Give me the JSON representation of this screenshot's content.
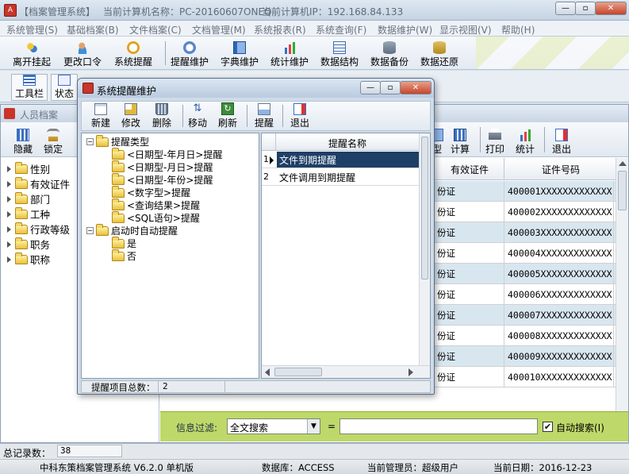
{
  "main_window": {
    "title": "【档案管理系统】",
    "computer_label": "当前计算机名称：PC-20160607ONEQ",
    "ip_label": "当前计算机IP：192.168.84.133"
  },
  "menu": [
    "系统管理(S)",
    "基础档案(B)",
    "文件档案(C)",
    "文档管理(M)",
    "系统报表(R)",
    "系统查询(F)",
    "数据维护(W)",
    "显示视图(V)",
    "帮助(H)"
  ],
  "main_toolbar": [
    "离开挂起",
    "更改口令",
    "系统提醒",
    "提醒维护",
    "字典维护",
    "统计维护",
    "数据结构",
    "数据备份",
    "数据还原"
  ],
  "sub_toolbar": [
    "工具栏",
    "状态"
  ],
  "person_window": {
    "title": "人员档案",
    "toolbar_left": [
      "隐藏",
      "锁定"
    ],
    "toolbar_right": [
      "型",
      "计算",
      "打印",
      "统计",
      "退出"
    ],
    "tree": [
      "性别",
      "有效证件",
      "部门",
      "工种",
      "行政等级",
      "职务",
      "职称"
    ],
    "grid_headers": [
      "有效证件",
      "证件号码"
    ],
    "rows": [
      [
        "份证",
        "400001XXXXXXXXXXXXX"
      ],
      [
        "份证",
        "400002XXXXXXXXXXXXX"
      ],
      [
        "份证",
        "400003XXXXXXXXXXXXX"
      ],
      [
        "份证",
        "400004XXXXXXXXXXXXX"
      ],
      [
        "份证",
        "400005XXXXXXXXXXXXX"
      ],
      [
        "份证",
        "400006XXXXXXXXXXXXX"
      ],
      [
        "份证",
        "400007XXXXXXXXXXXXX"
      ],
      [
        "份证",
        "400008XXXXXXXXXXXXX"
      ],
      [
        "份证",
        "400009XXXXXXXXXXXXX"
      ],
      [
        "份证",
        "400010XXXXXXXXXXXXX"
      ]
    ],
    "filter_label": "信息过滤:",
    "filter_value": "全文搜索",
    "equals": "=",
    "auto_search_label": "自动搜索(I)",
    "auto_search_checked": true
  },
  "dialog": {
    "title": "系统提醒维护",
    "toolbar": [
      "新建",
      "修改",
      "删除",
      "移动",
      "刷新",
      "提醒",
      "退出"
    ],
    "tree": [
      {
        "label": "提醒类型",
        "level": 0
      },
      {
        "label": "<日期型-年月日>提醒",
        "level": 1
      },
      {
        "label": "<日期型-月日>提醒",
        "level": 1
      },
      {
        "label": "<日期型-年份>提醒",
        "level": 1
      },
      {
        "label": "<数字型>提醒",
        "level": 1
      },
      {
        "label": "<查询结果>提醒",
        "level": 1
      },
      {
        "label": "<SQL语句>提醒",
        "level": 1
      },
      {
        "label": "启动时自动提醒",
        "level": 0
      },
      {
        "label": "是",
        "level": 1
      },
      {
        "label": "否",
        "level": 1
      }
    ],
    "grid_header": "提醒名称",
    "grid_rows": [
      {
        "num": "1",
        "name": "文件到期提醒"
      },
      {
        "num": "2",
        "name": "文件调用到期提醒"
      }
    ],
    "status_label": "提醒项目总数：",
    "status_value": "2"
  },
  "statusbar": {
    "total_label": "总记录数：",
    "total_value": "38",
    "product": "中科东策档案管理系统 V6.2.0 单机版",
    "database": "数据库：ACCESS",
    "admin": "当前管理员：超级用户",
    "date": "当前日期：2016-12-23"
  }
}
